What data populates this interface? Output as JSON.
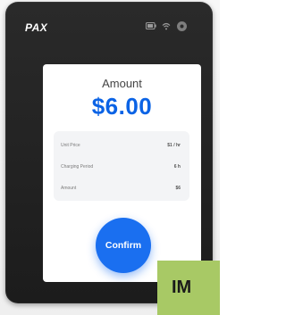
{
  "device": {
    "brand": "PAX",
    "status_icons": [
      "battery-icon",
      "wifi-icon",
      "settings-icon"
    ]
  },
  "payment": {
    "amount_label": "Amount",
    "amount_value": "$6.00",
    "details": [
      {
        "label": "Unit Price",
        "value": "$1 / hr"
      },
      {
        "label": "Charging Period",
        "value": "6 h"
      },
      {
        "label": "Amount",
        "value": "$6"
      }
    ],
    "confirm_label": "Confirm"
  },
  "overlay": {
    "badge_text": "IM"
  },
  "colors": {
    "accent": "#1a6ff0",
    "amount": "#0b63e5",
    "device": "#1f1f1f",
    "badge": "#a8c965"
  }
}
